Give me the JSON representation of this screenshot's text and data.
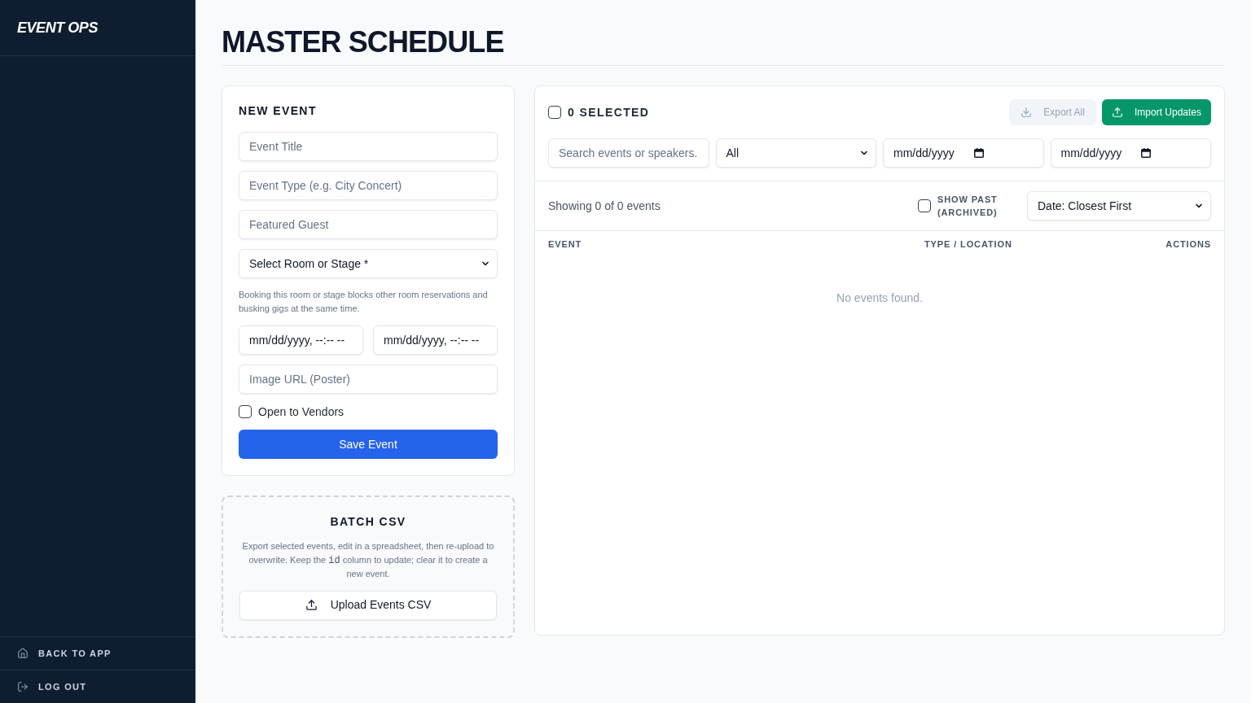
{
  "sidebar": {
    "brand": "EVENT OPS",
    "footer_items": [
      {
        "label": "BACK TO APP"
      },
      {
        "label": "LOG OUT"
      }
    ]
  },
  "page": {
    "title": "MASTER SCHEDULE"
  },
  "new_event": {
    "heading": "NEW EVENT",
    "fields": [
      {
        "placeholder": "Event Title"
      },
      {
        "placeholder": "Event Type (e.g. City Concert)"
      },
      {
        "placeholder": "Featured Guest"
      }
    ],
    "room_select": {
      "value": "Select Room or Stage *"
    },
    "hint": "Booking this room or stage blocks other room reservations and busking gigs at the same time.",
    "start": {
      "value": "mm/dd/yyyy, --:-- --"
    },
    "end": {
      "value": "mm/dd/yyyy, --:-- --"
    },
    "image_url": {
      "placeholder": "Image URL (Poster)"
    },
    "open_to_vendors": {
      "label": "Open to Vendors",
      "checked": false
    },
    "save_button": "Save Event"
  },
  "batch_csv": {
    "heading": "BATCH CSV",
    "description": {
      "before": "Export selected events, edit in a spreadsheet, then re-upload to overwrite. Keep the",
      "code": "id",
      "after": "column to update; clear it to create a new event."
    },
    "upload_button": "Upload Events CSV"
  },
  "events_panel": {
    "select_all": {
      "label": "0 SELECTED",
      "checked": false
    },
    "export_button": {
      "label": "Export All",
      "disabled": true
    },
    "import_button": {
      "label": "Import Updates"
    },
    "search": {
      "placeholder": "Search events or speakers."
    },
    "type_filter": {
      "value": "All"
    },
    "date_from": {
      "value": "mm/dd/yyyy"
    },
    "date_to": {
      "value": "mm/dd/yyyy"
    },
    "summary": "Showing 0 of 0 events",
    "show_past": {
      "label": "SHOW PAST (ARCHIVED)",
      "checked": false
    },
    "sort_select": {
      "value": "Date: Closest First"
    },
    "table": {
      "columns": [
        "EVENT",
        "TYPE / LOCATION",
        "ACTIONS"
      ],
      "empty_message": "No events found."
    }
  }
}
